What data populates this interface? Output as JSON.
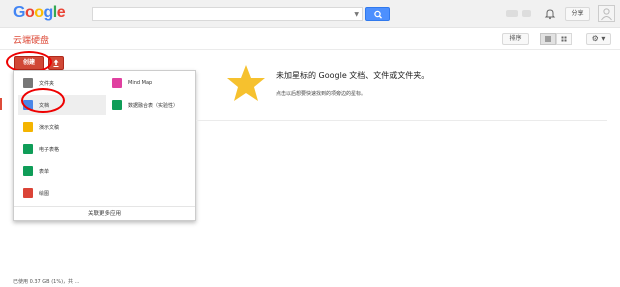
{
  "header": {
    "logo_letters": [
      {
        "ch": "G",
        "color": "#4285f4"
      },
      {
        "ch": "o",
        "color": "#ea4335"
      },
      {
        "ch": "o",
        "color": "#fbbc05"
      },
      {
        "ch": "g",
        "color": "#4285f4"
      },
      {
        "ch": "l",
        "color": "#34a853"
      },
      {
        "ch": "e",
        "color": "#ea4335"
      }
    ],
    "search_value": "",
    "share_label": "分享"
  },
  "toolbar": {
    "drive_title": "云端硬盘",
    "sort_label": "排序",
    "settings_symbol": "⚙ ▾"
  },
  "create": {
    "create_label": "创建"
  },
  "menu": {
    "left_items": [
      {
        "label": "文件夹",
        "icon": "folder-icon",
        "color": "#777777"
      },
      {
        "label": "文档",
        "icon": "document-icon",
        "color": "#4a86e8"
      },
      {
        "label": "演示文稿",
        "icon": "presentation-icon",
        "color": "#f4b400"
      },
      {
        "label": "电子表格",
        "icon": "spreadsheet-icon",
        "color": "#0f9d58"
      },
      {
        "label": "表单",
        "icon": "form-icon",
        "color": "#0f9d58"
      },
      {
        "label": "绘图",
        "icon": "drawing-icon",
        "color": "#db4437"
      }
    ],
    "right_items": [
      {
        "label": "Mind Map",
        "icon": "mindmap-icon",
        "color": "#e040a0"
      },
      {
        "label": "数据融合表（实验性）",
        "icon": "fusion-tables-icon",
        "color": "#0f9d58"
      }
    ],
    "footer_label": "关联更多应用",
    "highlighted_index": 1
  },
  "empty_state": {
    "title": "未加星标的 Google 文档、文件或文件夹。",
    "subtitle": "点击以后想要快速找到的项旁边的星标。"
  },
  "storage": {
    "text": "已使用 0.37 GB (1%)，共 ..."
  }
}
